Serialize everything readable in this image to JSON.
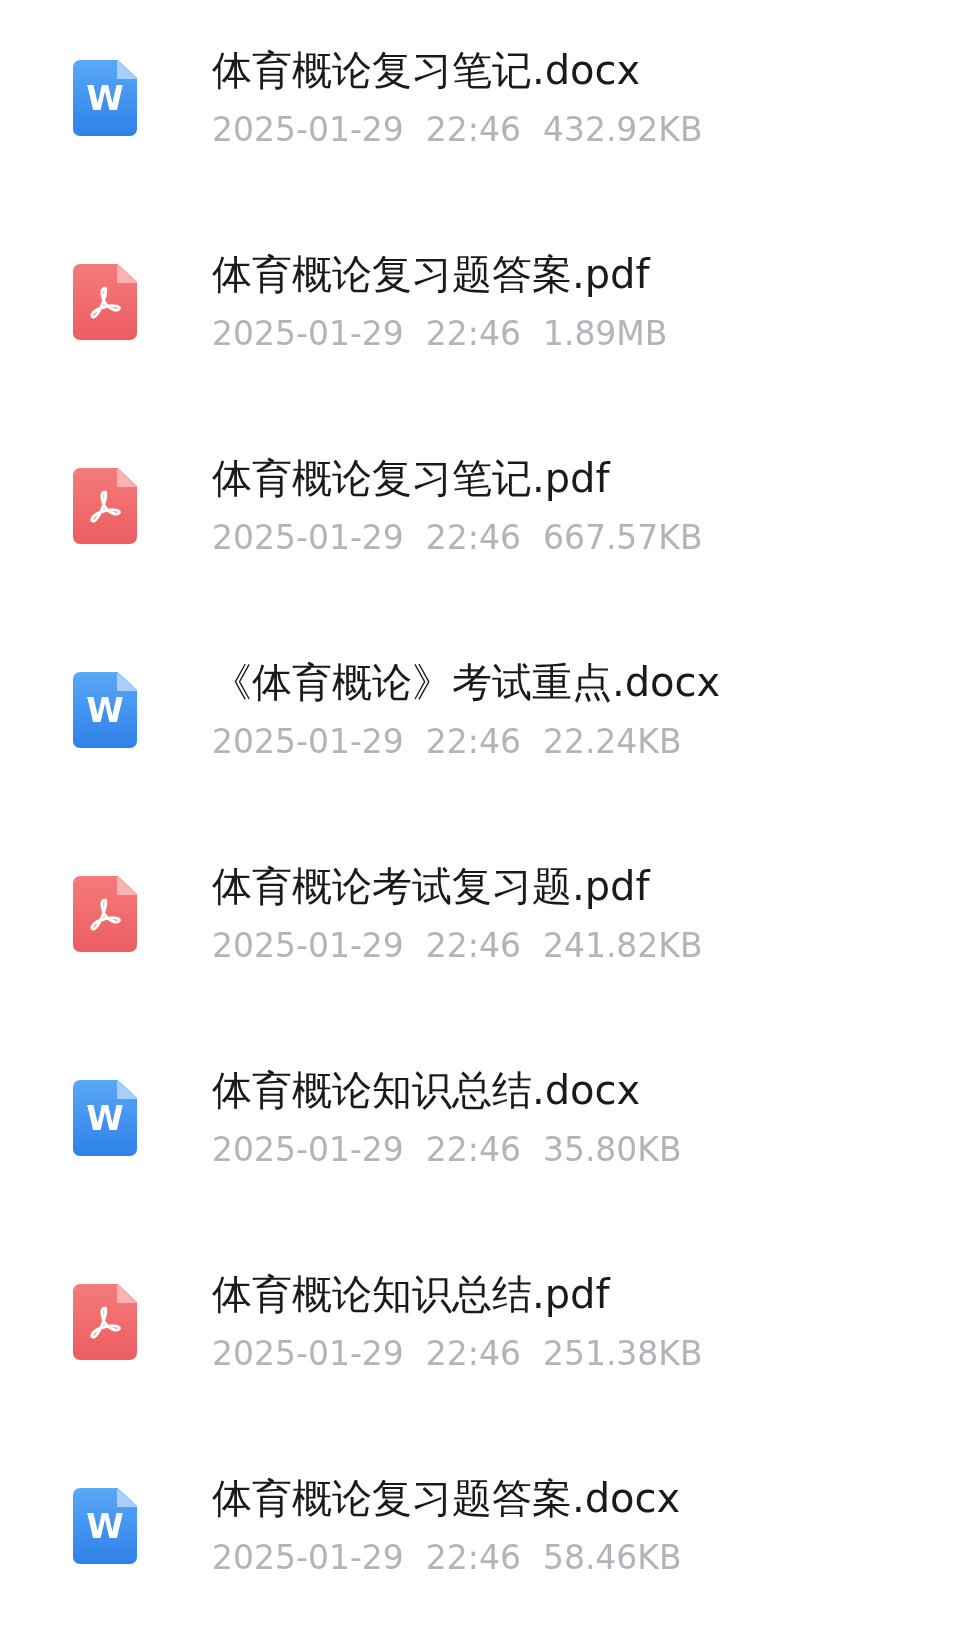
{
  "files": [
    {
      "kind": "word",
      "icon_label": "W",
      "name": "体育概论复习笔记.docx",
      "date": "2025-01-29",
      "time": "22:46",
      "size": "432.92KB"
    },
    {
      "kind": "pdf",
      "name": "体育概论复习题答案.pdf",
      "date": "2025-01-29",
      "time": "22:46",
      "size": "1.89MB"
    },
    {
      "kind": "pdf",
      "name": "体育概论复习笔记.pdf",
      "date": "2025-01-29",
      "time": "22:46",
      "size": "667.57KB"
    },
    {
      "kind": "word",
      "icon_label": "W",
      "name": "《体育概论》考试重点.docx",
      "date": "2025-01-29",
      "time": "22:46",
      "size": "22.24KB"
    },
    {
      "kind": "pdf",
      "name": "体育概论考试复习题.pdf",
      "date": "2025-01-29",
      "time": "22:46",
      "size": "241.82KB"
    },
    {
      "kind": "word",
      "icon_label": "W",
      "name": "体育概论知识总结.docx",
      "date": "2025-01-29",
      "time": "22:46",
      "size": "35.80KB"
    },
    {
      "kind": "pdf",
      "name": "体育概论知识总结.pdf",
      "date": "2025-01-29",
      "time": "22:46",
      "size": "251.38KB"
    },
    {
      "kind": "word",
      "icon_label": "W",
      "name": "体育概论复习题答案.docx",
      "date": "2025-01-29",
      "time": "22:46",
      "size": "58.46KB"
    }
  ]
}
